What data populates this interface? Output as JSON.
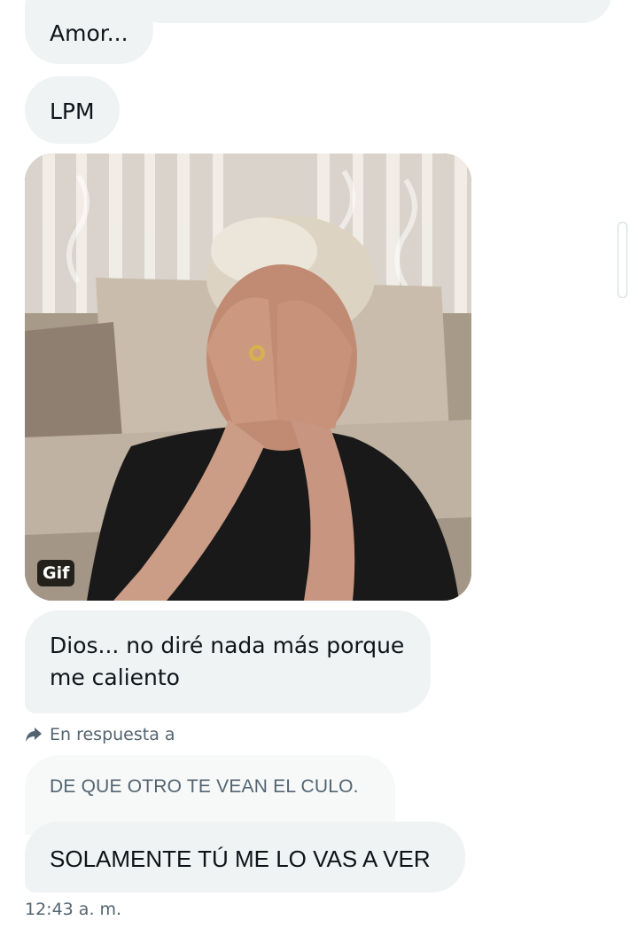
{
  "conversation": {
    "messages": [
      {
        "text": "Amor..."
      },
      {
        "text": "LPM"
      },
      {
        "text": "Dios... no diré nada más porque me caliento"
      },
      {
        "text": "SOLAMENTE TÚ ME LO VAS A VER"
      }
    ],
    "gif": {
      "badge": "Gif"
    },
    "reply": {
      "label": "En respuesta a",
      "quoted_text": "DE QUE OTRO TE VEAN EL CULO."
    },
    "timestamp": "12:43 a. m."
  },
  "icons": {
    "reply": "reply-arrow-icon"
  }
}
